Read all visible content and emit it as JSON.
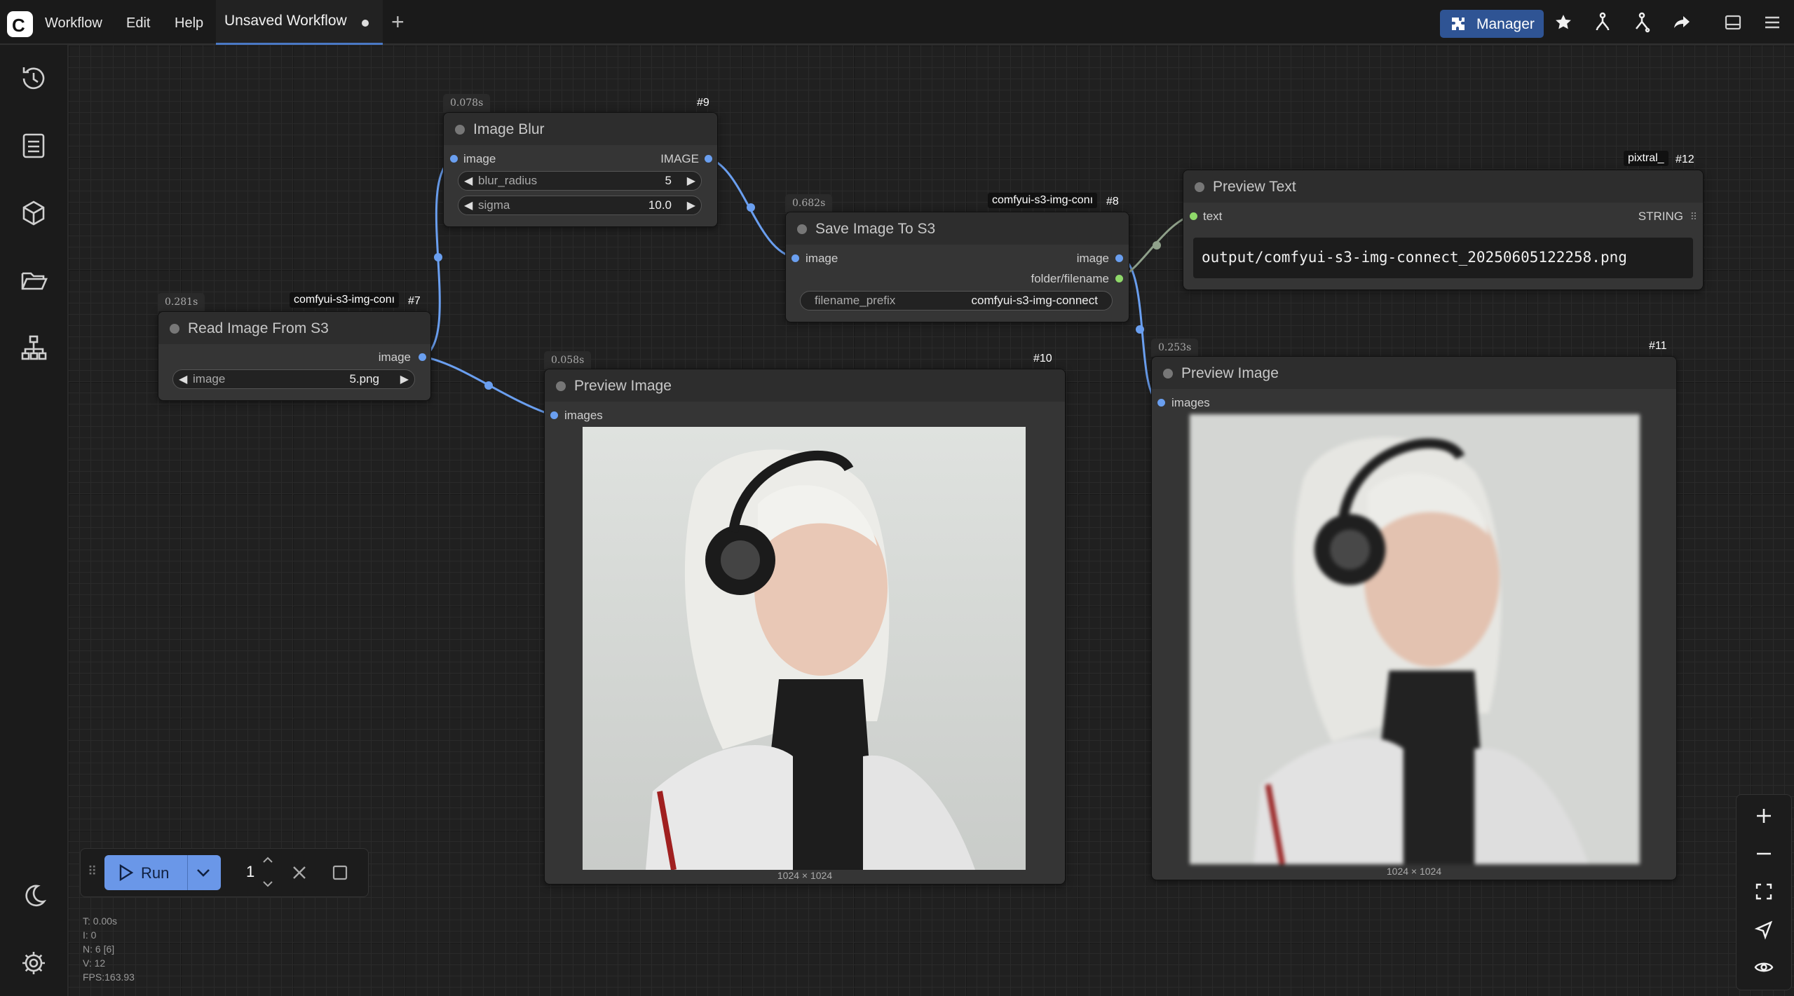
{
  "topbar": {
    "logo_letter": "C",
    "menu": [
      "Workflow",
      "Edit",
      "Help"
    ],
    "active_tab": "Unsaved Workflow",
    "new_tab_glyph": "+",
    "manager_label": "Manager",
    "icons": [
      "puzzle-icon",
      "star-icon",
      "git-branch-icon",
      "git-compare-icon",
      "share-icon",
      "panel-toggle-icon",
      "hamburger-menu-icon"
    ]
  },
  "sidebar": {
    "icons": [
      "history-icon",
      "list-icon",
      "cube-icon",
      "folder-open-icon",
      "sitemap-icon",
      "moon-icon",
      "gear-icon"
    ]
  },
  "nodes": {
    "image_blur": {
      "time": "0.078s",
      "id": "#9",
      "title": "Image Blur",
      "input": "image",
      "output": "IMAGE",
      "blur_radius_label": "blur_radius",
      "blur_radius_value": "5",
      "sigma_label": "sigma",
      "sigma_value": "10.0"
    },
    "read_image": {
      "time": "0.281s",
      "source": "comfyui-s3-img-conı",
      "id": "#7",
      "title": "Read Image From S3",
      "output": "image",
      "widget_label": "image",
      "widget_value": "5.png"
    },
    "save_image": {
      "time": "0.682s",
      "source": "comfyui-s3-img-conı",
      "id": "#8",
      "title": "Save Image To S3",
      "input": "image",
      "output1": "image",
      "output2": "folder/filename",
      "prefix_label": "filename_prefix",
      "prefix_value": "comfyui-s3-img-connect"
    },
    "preview_text": {
      "source": "pixtral_",
      "id": "#12",
      "title": "Preview Text",
      "input": "text",
      "output": "STRING",
      "content": "output/comfyui-s3-img-connect_20250605122258.png"
    },
    "preview_image_10": {
      "time": "0.058s",
      "id": "#10",
      "title": "Preview Image",
      "input": "images",
      "caption": "1024 × 1024"
    },
    "preview_image_11": {
      "time": "0.253s",
      "id": "#11",
      "title": "Preview Image",
      "input": "images",
      "caption": "1024 × 1024"
    }
  },
  "runbar": {
    "run_label": "Run",
    "count": "1"
  },
  "stats": [
    "T: 0.00s",
    "I: 0",
    "N: 6 [6]",
    "V: 12",
    "FPS:163.93"
  ],
  "colors": {
    "accent": "#2f5494",
    "run": "#6a97e8",
    "link_image": "#6a9ff0",
    "link_string": "#8fd96a"
  }
}
